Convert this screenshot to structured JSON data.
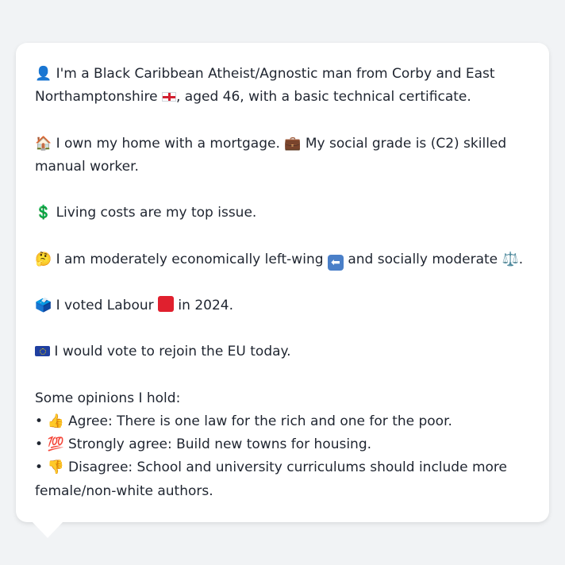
{
  "card": {
    "identity": {
      "icon": "👤",
      "text_before_flag": " I'm a Black Caribbean Atheist/Agnostic man from Corby and East Northamptonshire ",
      "flag_icon": "england-flag-icon",
      "text_after_flag": ", aged 46, with a basic technical certificate."
    },
    "home": {
      "icon": "🏠",
      "text1": " I own my home with a mortgage. ",
      "icon2": "💼",
      "text2": " My social grade is (C2) skilled manual worker."
    },
    "issue": {
      "icon": "💲",
      "text": " Living costs are my top issue."
    },
    "politics": {
      "icon": "🤔",
      "text1": " I am moderately economically left-wing ",
      "arrow_icon": "⬅",
      "text2": " and socially moderate ",
      "scales_icon": "⚖️",
      "text3": "."
    },
    "vote": {
      "icon": "🗳️",
      "text1": " I voted Labour ",
      "square_icon": "red-square-icon",
      "text2": " in 2024."
    },
    "eu": {
      "flag_icon": "eu-flag-icon",
      "text": " I would vote to rejoin the EU today."
    },
    "opinions": {
      "heading": "Some opinions I hold:",
      "items": [
        {
          "bullet": "•",
          "icon": "👍",
          "text": " Agree: There is one law for the rich and one for the poor."
        },
        {
          "bullet": "•",
          "icon": "💯",
          "text": " Strongly agree: Build new towns for housing."
        },
        {
          "bullet": "•",
          "icon": "👎",
          "text": " Disagree: School and university curriculums should include more female/non-white authors."
        }
      ]
    }
  },
  "colors": {
    "background": "#f1f3f5",
    "card": "#ffffff",
    "text": "#1f2530",
    "labour_red": "#e0202e"
  }
}
